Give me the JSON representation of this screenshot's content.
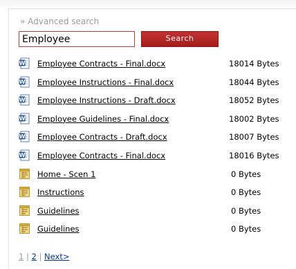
{
  "search": {
    "advanced_link": "» Advanced search",
    "query": "Employee",
    "button_label": "Search"
  },
  "results": [
    {
      "type": "document",
      "icon": "word-document-icon",
      "name": "Employee Contracts - Final.docx",
      "size": "18014 Bytes"
    },
    {
      "type": "document",
      "icon": "word-document-icon",
      "name": "Employee Instructions - Final.docx",
      "size": "18044 Bytes"
    },
    {
      "type": "document",
      "icon": "word-document-icon",
      "name": "Employee Instructions - Draft.docx",
      "size": "18052 Bytes"
    },
    {
      "type": "document",
      "icon": "word-document-icon",
      "name": "Employee Guidelines - Final.docx",
      "size": "18002 Bytes"
    },
    {
      "type": "document",
      "icon": "word-document-icon",
      "name": "Employee Contracts - Draft.docx",
      "size": "18007 Bytes"
    },
    {
      "type": "document",
      "icon": "word-document-icon",
      "name": "Employee Contracts - Final.docx",
      "size": "18016 Bytes"
    },
    {
      "type": "page",
      "icon": "page-icon",
      "name": "Home - Scen 1",
      "size": "0 Bytes"
    },
    {
      "type": "page",
      "icon": "page-icon",
      "name": "Instructions",
      "size": "0 Bytes"
    },
    {
      "type": "page",
      "icon": "page-icon",
      "name": "Guidelines",
      "size": "0 Bytes"
    },
    {
      "type": "page",
      "icon": "page-icon",
      "name": "Guidelines",
      "size": "0 Bytes"
    }
  ],
  "pager": {
    "current": "1",
    "separator": "|",
    "page2": "2",
    "next": "Next>"
  },
  "colors": {
    "accent": "#b32424",
    "input_border": "#c43a3a",
    "muted_text": "#9a9a9a",
    "link_blue": "#003399"
  }
}
